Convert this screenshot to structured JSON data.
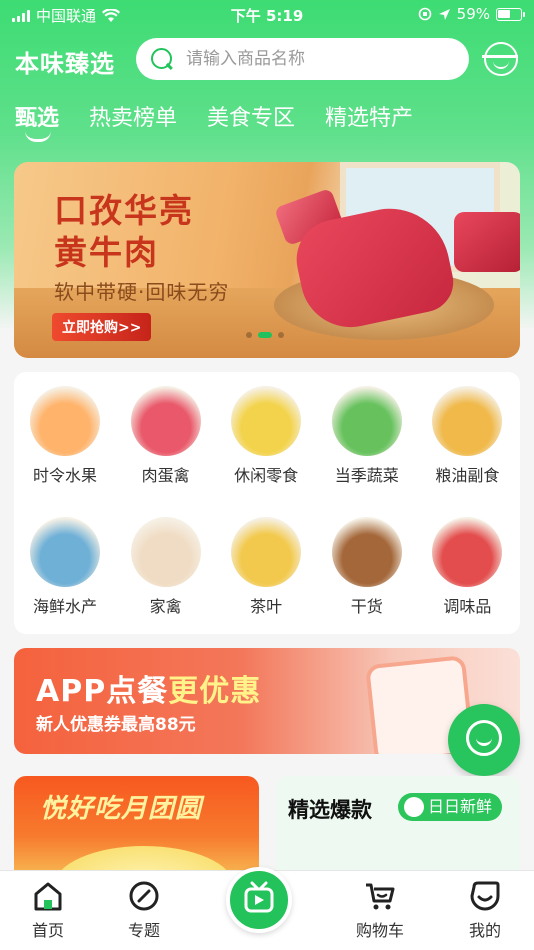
{
  "status_bar": {
    "carrier": "中国联通",
    "time": "下午 5:19",
    "battery": "59%",
    "battery_level": 0.59
  },
  "header": {
    "brand": "本味臻选",
    "search_placeholder": "请输入商品名称"
  },
  "tabs": [
    {
      "label": "甄选",
      "active": true
    },
    {
      "label": "热卖榜单",
      "active": false
    },
    {
      "label": "美食专区",
      "active": false
    },
    {
      "label": "精选特产",
      "active": false
    }
  ],
  "banner": {
    "title_line1": "口孜华亮",
    "title_line2": "黄牛肉",
    "subtitle": "软中带硬·回味无穷",
    "button": "立即抢购>>",
    "slide_count": 3,
    "active_slide": 2
  },
  "categories": [
    {
      "label": "时令水果",
      "icon": "fruit-icon",
      "color": "#ffb36b"
    },
    {
      "label": "肉蛋禽",
      "icon": "meat-egg-icon",
      "color": "#e9596b"
    },
    {
      "label": "休闲零食",
      "icon": "snack-icon",
      "color": "#f3d34c"
    },
    {
      "label": "当季蔬菜",
      "icon": "vegetable-icon",
      "color": "#67c25e"
    },
    {
      "label": "粮油副食",
      "icon": "grain-oil-icon",
      "color": "#f0b94a"
    },
    {
      "label": "海鲜水产",
      "icon": "seafood-icon",
      "color": "#6fb0d7"
    },
    {
      "label": "家禽",
      "icon": "poultry-icon",
      "color": "#f0dcc4"
    },
    {
      "label": "茶叶",
      "icon": "tea-icon",
      "color": "#f2c94c"
    },
    {
      "label": "干货",
      "icon": "dried-goods-icon",
      "color": "#a4673a"
    },
    {
      "label": "调味品",
      "icon": "seasoning-icon",
      "color": "#e34d4d"
    }
  ],
  "promo": {
    "title_a": "APP点餐",
    "title_b": "更优惠",
    "subtitle": "新人优惠券最高88元"
  },
  "cards": {
    "left_title": "悦好吃月团圆",
    "right_title": "精选爆款",
    "right_badge": "日日新鲜"
  },
  "tabbar": [
    {
      "label": "首页",
      "icon": "home-icon"
    },
    {
      "label": "专题",
      "icon": "compass-icon"
    },
    {
      "label": "",
      "icon": "live-tv-icon"
    },
    {
      "label": "购物车",
      "icon": "cart-icon"
    },
    {
      "label": "我的",
      "icon": "profile-icon"
    }
  ],
  "colors": {
    "brand_green": "#23c25a",
    "promo_orange": "#f5623d"
  }
}
